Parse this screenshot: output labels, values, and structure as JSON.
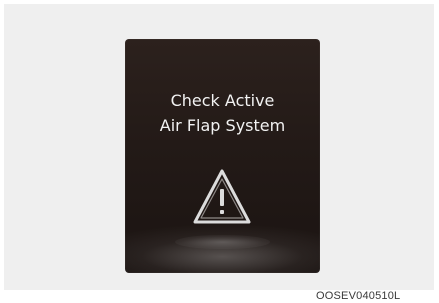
{
  "display": {
    "message_line1": "Check Active",
    "message_line2": "Air Flap System",
    "icon": "warning-triangle-icon"
  },
  "reference_code": "OOSEV040510L",
  "colors": {
    "screen_background": "#231a17",
    "text": "#f2f2f2",
    "page_background": "#efefef"
  }
}
